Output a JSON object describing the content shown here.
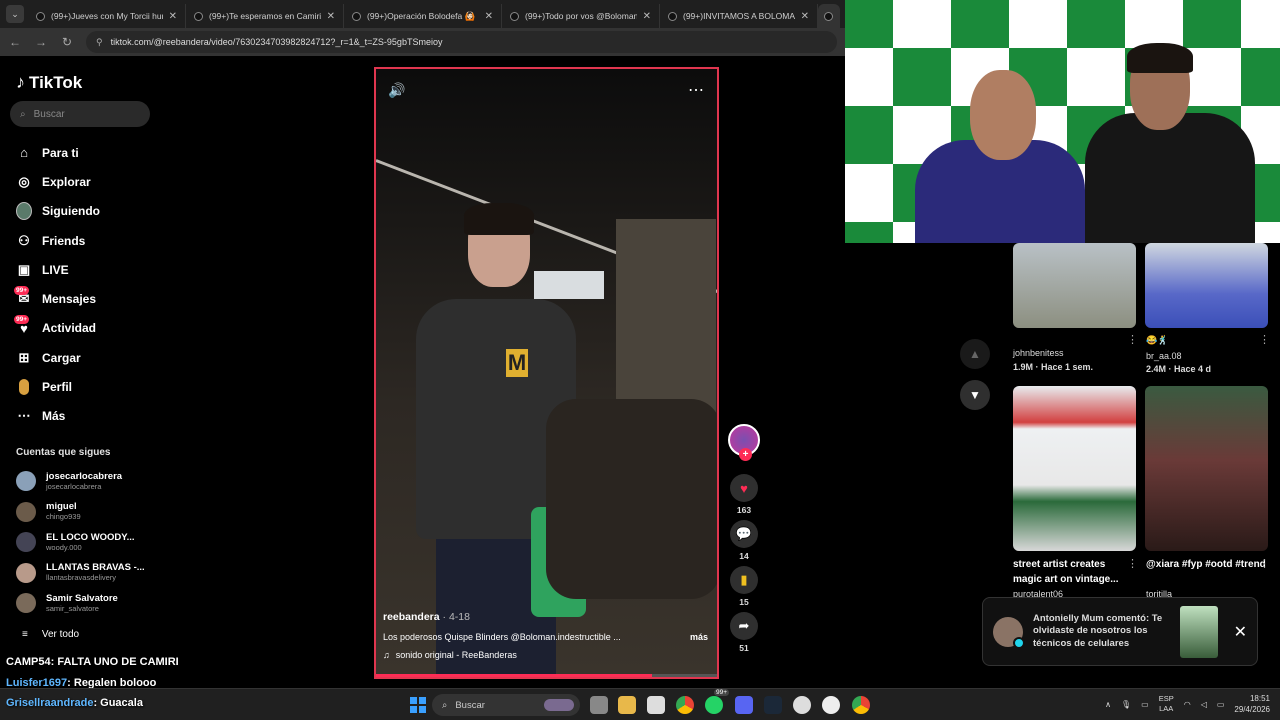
{
  "browser": {
    "tabs": [
      {
        "title": "(99+)Jueves con My Torcii hum"
      },
      {
        "title": "(99+)Te esperamos en Camiri l"
      },
      {
        "title": "(99+)Operación Bolodefa 🙆🏻"
      },
      {
        "title": "(99+)Todo por vos @Boloman"
      },
      {
        "title": "(99+)INVITAMOS A BOLOMAN"
      }
    ],
    "url": "tiktok.com/@reebandera/video/7630234703982824712?_r=1&_t=ZS-95gbTSmeioy"
  },
  "sidebar": {
    "logo": "TikTok",
    "search_placeholder": "Buscar",
    "nav": [
      {
        "label": "Para ti",
        "icon": "home-icon"
      },
      {
        "label": "Explorar",
        "icon": "compass-icon"
      },
      {
        "label": "Siguiendo",
        "icon": "following-avatar-icon"
      },
      {
        "label": "Friends",
        "icon": "friends-icon"
      },
      {
        "label": "LIVE",
        "icon": "live-icon"
      },
      {
        "label": "Mensajes",
        "icon": "messages-icon",
        "badge": "99+"
      },
      {
        "label": "Actividad",
        "icon": "activity-icon",
        "badge": "99+"
      },
      {
        "label": "Cargar",
        "icon": "upload-icon"
      },
      {
        "label": "Perfil",
        "icon": "profile-icon"
      },
      {
        "label": "Más",
        "icon": "more-icon"
      }
    ],
    "following_title": "Cuentas que sigues",
    "following": [
      {
        "name": "josecarlocabrera",
        "handle": "josecarlocabrera"
      },
      {
        "name": "miguel",
        "handle": "chingo939"
      },
      {
        "name": "EL LOCO WOODY...",
        "handle": "woody.000"
      },
      {
        "name": "LLANTAS BRAVAS -...",
        "handle": "llantasbravasdelivery"
      },
      {
        "name": "Samir Salvatore",
        "handle": "samir_salvatore"
      }
    ],
    "see_all": "Ver todo"
  },
  "video": {
    "user": "reebandera",
    "date": "· 4-18",
    "description": "Los poderosos Quispe Blinders @Boloman.indestructible ...",
    "more": "más",
    "sound": "sonido original - ReeBanderas",
    "progress": 0.81
  },
  "actions": {
    "likes": "163",
    "comments": "14",
    "saves": "15",
    "shares": "51"
  },
  "recommended": [
    {
      "user": "johnbenitess",
      "stats": "1.9M · Hace 1 sem."
    },
    {
      "user": "br_aa.08",
      "stats": "2.4M · Hace 4 d",
      "prefix": "😂🕺"
    },
    {
      "title": "street artist creates magic art on vintage...",
      "user": "purotalent06"
    },
    {
      "title": "@xiara #fyp #ootd #trend",
      "user": "toritilla"
    }
  ],
  "notification": {
    "text": "Antonielly Mum comentó: Te olvidaste de nosotros los técnicos de celulares"
  },
  "chat": [
    {
      "user": "CAMP54",
      "message": ": FALTA UNO DE CAMIRI"
    },
    {
      "user": "Luisfer1697",
      "message": ": Regalen bolooo"
    },
    {
      "user": "Grisellraandrade",
      "message": ": Guacala"
    }
  ],
  "taskbar": {
    "search": "Buscar",
    "lang": "ESP",
    "lang2": "LAA",
    "time": "18:51",
    "date": "29/4/2026",
    "badge": "99+"
  },
  "colors": {
    "accent": "#fe2c55",
    "video_border": "#e0364f",
    "webcam_green": "#1a8a3a"
  }
}
